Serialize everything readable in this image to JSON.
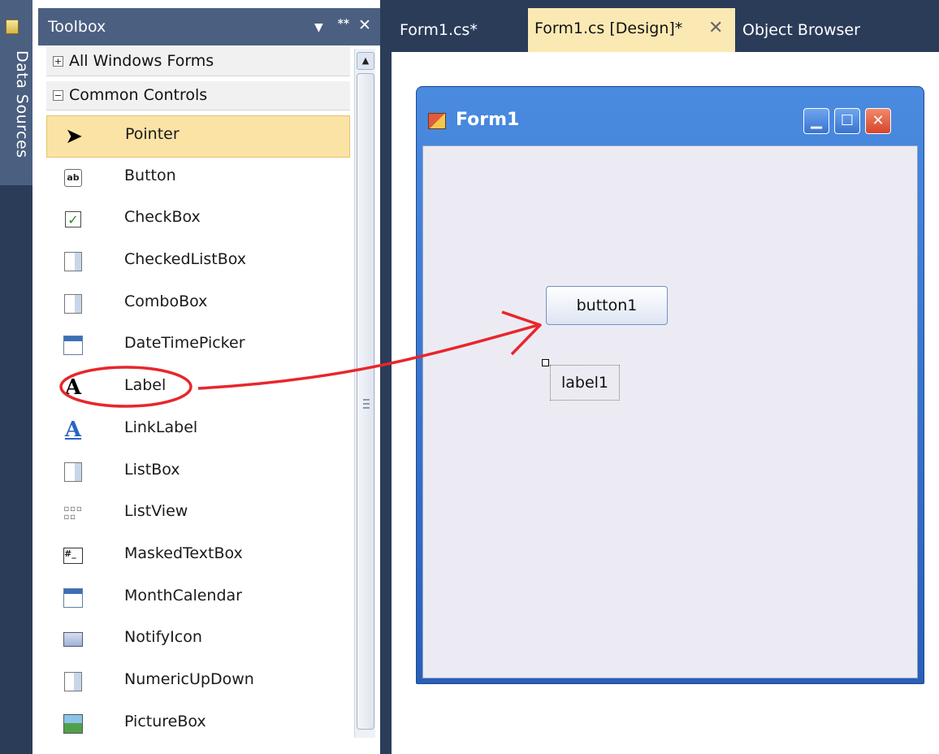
{
  "sidebar": {
    "data_sources_label": "Data Sources"
  },
  "toolbox": {
    "title": "Toolbox",
    "header_buttons": {
      "dropdown": "▼",
      "pin": "ᕯ",
      "close": "✕"
    },
    "groups": [
      {
        "label": "All Windows Forms",
        "expander": "+"
      },
      {
        "label": "Common Controls",
        "expander": "−"
      }
    ],
    "items": [
      {
        "label": "Pointer",
        "icon": "pointer-icon",
        "selected": true
      },
      {
        "label": "Button",
        "icon": "button-icon"
      },
      {
        "label": "CheckBox",
        "icon": "checkbox-icon"
      },
      {
        "label": "CheckedListBox",
        "icon": "checked-list-box-icon"
      },
      {
        "label": "ComboBox",
        "icon": "combobox-icon"
      },
      {
        "label": "DateTimePicker",
        "icon": "datetime-picker-icon"
      },
      {
        "label": "Label",
        "icon": "label-icon"
      },
      {
        "label": "LinkLabel",
        "icon": "link-label-icon"
      },
      {
        "label": "ListBox",
        "icon": "listbox-icon"
      },
      {
        "label": "ListView",
        "icon": "listview-icon"
      },
      {
        "label": "MaskedTextBox",
        "icon": "masked-textbox-icon"
      },
      {
        "label": "MonthCalendar",
        "icon": "month-calendar-icon"
      },
      {
        "label": "NotifyIcon",
        "icon": "notify-icon"
      },
      {
        "label": "NumericUpDown",
        "icon": "numeric-updown-icon"
      },
      {
        "label": "PictureBox",
        "icon": "picturebox-icon"
      }
    ]
  },
  "tabs": [
    {
      "label": "Form1.cs*",
      "active": false
    },
    {
      "label": "Form1.cs [Design]*",
      "active": true,
      "close": "✕"
    },
    {
      "label": "Object Browser",
      "active": false
    }
  ],
  "designer": {
    "form_title": "Form1",
    "window_buttons": {
      "minimize": "▁",
      "maximize": "☐",
      "close": "✕"
    },
    "button1_text": "button1",
    "label1_text": "label1"
  },
  "colors": {
    "ide_frame": "#2b3c59",
    "panel_header": "#4b5f80",
    "selected_item": "#fbe3a6",
    "active_tab": "#fbe9b4",
    "annotation": "#e8262b"
  }
}
